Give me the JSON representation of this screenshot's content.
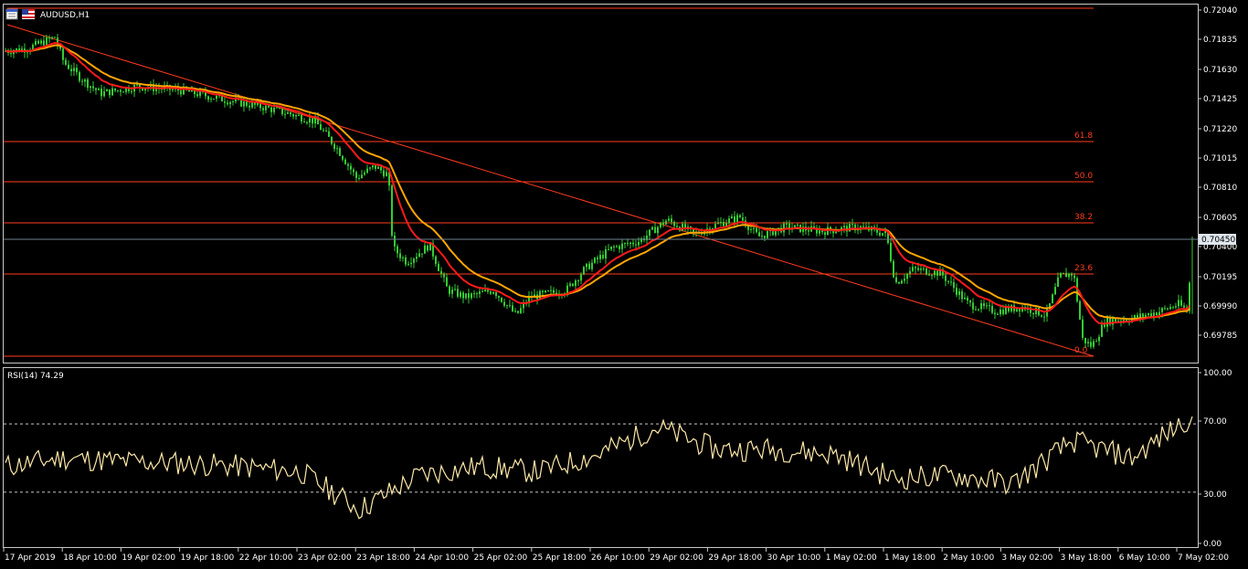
{
  "window": {
    "symbol_title": "AUDUSD,H1"
  },
  "colors": {
    "background": "#000000",
    "frame": "#c8c8c8",
    "candle": "#33cc33",
    "ma_fast": "#ff1a1a",
    "ma_slow": "#ffa500",
    "fib": "#ff3c1e",
    "trendline": "#ff3c1e",
    "rsi": "#ffe9a8",
    "price_line": "#6f7f8f"
  },
  "icons": [
    "window-list-icon",
    "us-flag-icon"
  ],
  "price_axis": {
    "ticks": [
      "0.72040",
      "0.71835",
      "0.71630",
      "0.71425",
      "0.71220",
      "0.71015",
      "0.70810",
      "0.70605",
      "0.70400",
      "0.70195",
      "0.69990",
      "0.69785"
    ],
    "current_price": "0.70450",
    "range": [
      0.6961,
      0.721
    ]
  },
  "fib_levels": [
    {
      "label": "61.8"
    },
    {
      "label": "50.0"
    },
    {
      "label": "38.2"
    },
    {
      "label": "23.6"
    },
    {
      "label": "0.0"
    }
  ],
  "rsi_panel": {
    "title": "RSI(14) 74.29",
    "ticks": [
      "100.00",
      "70.00",
      "30.00",
      "0.00"
    ],
    "levels": [
      70,
      30
    ]
  },
  "time_axis": {
    "labels": [
      "17 Apr 2019",
      "18 Apr 10:00",
      "19 Apr 02:00",
      "19 Apr 18:00",
      "22 Apr 10:00",
      "23 Apr 02:00",
      "23 Apr 18:00",
      "24 Apr 10:00",
      "25 Apr 02:00",
      "25 Apr 18:00",
      "26 Apr 10:00",
      "29 Apr 02:00",
      "29 Apr 18:00",
      "30 Apr 10:00",
      "1 May 02:00",
      "1 May 18:00",
      "2 May 10:00",
      "3 May 02:00",
      "3 May 18:00",
      "6 May 10:00",
      "7 May 02:00"
    ]
  },
  "chart_data": {
    "type": "line",
    "title": "AUDUSD,H1",
    "description_series": [
      {
        "name": "price",
        "x": [
          "17 Apr 2019",
          "18 Apr 10:00",
          "19 Apr 02:00",
          "19 Apr 18:00",
          "22 Apr 10:00",
          "23 Apr 02:00",
          "23 Apr 18:00",
          "24 Apr 10:00",
          "25 Apr 02:00",
          "25 Apr 18:00",
          "26 Apr 10:00",
          "29 Apr 02:00",
          "29 Apr 18:00",
          "30 Apr 10:00",
          "1 May 02:00",
          "1 May 18:00",
          "2 May 10:00",
          "3 May 02:00",
          "3 May 18:00",
          "6 May 10:00",
          "7 May 02:00"
        ],
        "values": [
          0.7176,
          0.7168,
          0.715,
          0.715,
          0.7145,
          0.7135,
          0.7092,
          0.704,
          0.701,
          0.7005,
          0.7035,
          0.7058,
          0.7058,
          0.7052,
          0.7052,
          0.7035,
          0.702,
          0.7,
          0.699,
          0.7,
          0.7045
        ]
      }
    ],
    "rsi": {
      "x": [
        "17 Apr 2019",
        "18 Apr 10:00",
        "19 Apr 02:00",
        "19 Apr 18:00",
        "22 Apr 10:00",
        "23 Apr 02:00",
        "23 Apr 18:00",
        "24 Apr 10:00",
        "25 Apr 02:00",
        "25 Apr 18:00",
        "26 Apr 10:00",
        "29 Apr 02:00",
        "29 Apr 18:00",
        "30 Apr 10:00",
        "1 May 02:00",
        "1 May 18:00",
        "2 May 10:00",
        "3 May 02:00",
        "3 May 18:00",
        "6 May 10:00",
        "7 May 02:00"
      ],
      "values": [
        45,
        50,
        48,
        47,
        45,
        42,
        20,
        40,
        45,
        42,
        52,
        68,
        55,
        55,
        52,
        38,
        40,
        35,
        60,
        50,
        74.29
      ],
      "ylim": [
        0,
        100
      ]
    }
  }
}
